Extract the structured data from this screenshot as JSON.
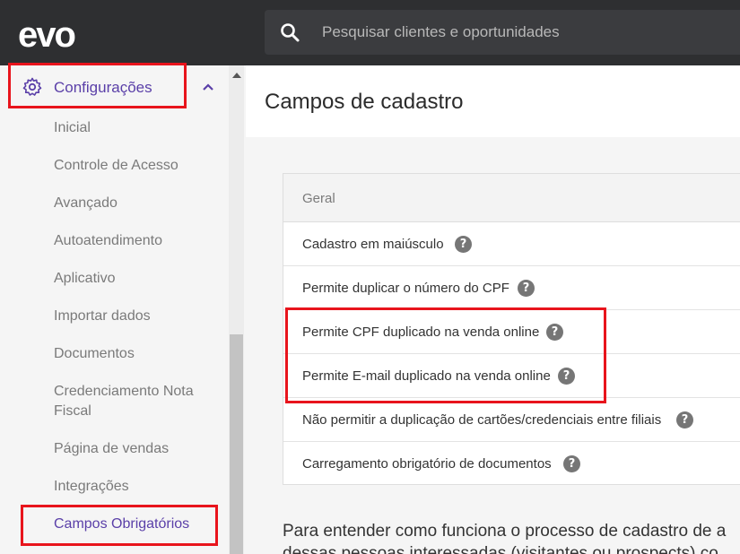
{
  "header": {
    "logo_text": "evo",
    "search": {
      "placeholder": "Pesquisar clientes e oportunidades",
      "value": ""
    }
  },
  "sidebar": {
    "section_label": "Configurações",
    "items": [
      {
        "label": "Inicial"
      },
      {
        "label": "Controle de Acesso"
      },
      {
        "label": "Avançado"
      },
      {
        "label": "Autoatendimento"
      },
      {
        "label": "Aplicativo"
      },
      {
        "label": "Importar dados"
      },
      {
        "label": "Documentos"
      },
      {
        "label": "Credenciamento Nota Fiscal"
      },
      {
        "label": "Página de vendas"
      },
      {
        "label": "Integrações"
      },
      {
        "label": "Campos Obrigatórios"
      }
    ],
    "active_item": "Campos Obrigatórios"
  },
  "main": {
    "title": "Campos de cadastro",
    "card": {
      "header": "Geral",
      "rows": [
        {
          "label": "Cadastro em maiúsculo"
        },
        {
          "label": "Permite duplicar o número do CPF"
        },
        {
          "label": "Permite CPF duplicado na venda online"
        },
        {
          "label": "Permite E-mail duplicado na venda online"
        },
        {
          "label": "Não permitir a duplicação de cartões/credenciais entre filiais"
        },
        {
          "label": "Carregamento obrigatório de documentos"
        }
      ]
    },
    "info_line1": "Para entender como funciona o processo de cadastro de a",
    "info_line2": "dessas pessoas interessadas (visitantes ou prospects) co"
  },
  "theme": {
    "accent": "#5a3fa8",
    "topbar": "#2e2f31",
    "highlight": "#e8141c"
  }
}
